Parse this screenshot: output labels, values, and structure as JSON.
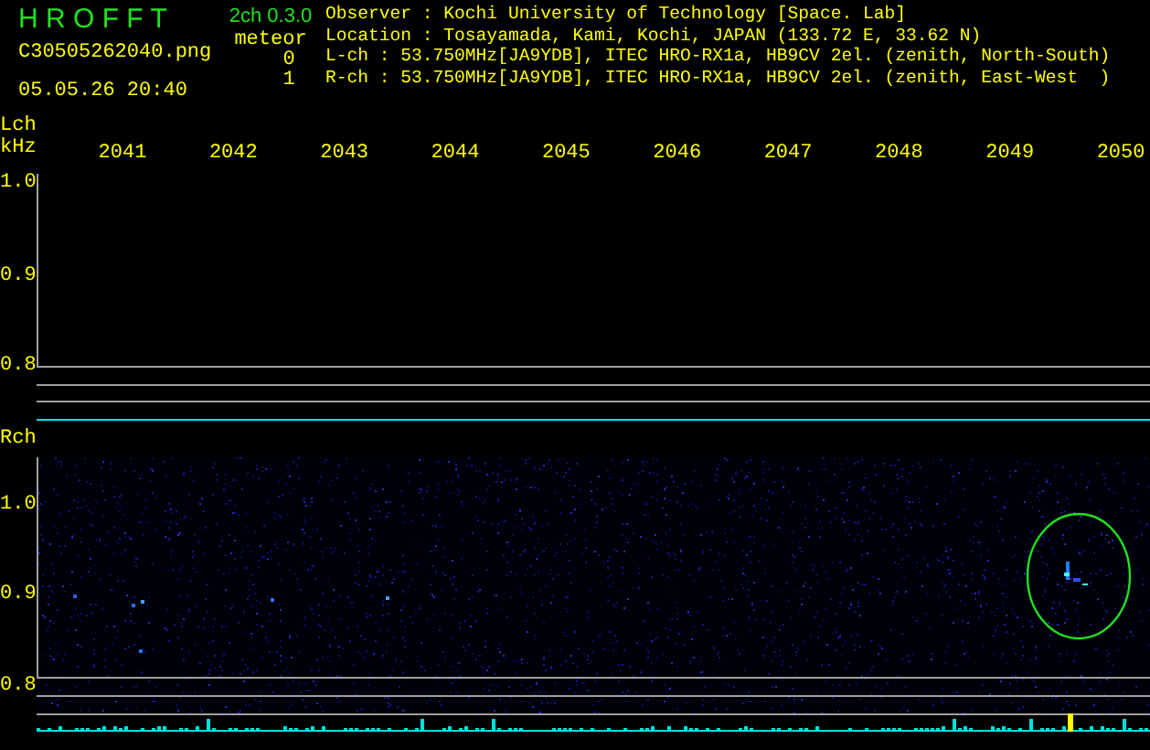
{
  "header": {
    "title": "H R O F F T",
    "version": "2ch 0.3.0",
    "filename": "C30505262040.png",
    "timestamp": "05.05.26 20:40"
  },
  "meteor": {
    "label": "meteor",
    "counts": [
      "0",
      "1"
    ]
  },
  "info": [
    "Observer : Kochi University of Technology [Space. Lab]",
    "Location : Tosayamada, Kami, Kochi, JAPAN (133.72 E, 33.62 N)",
    "L-ch : 53.750MHz[JA9YDB], ITEC HRO-RX1a, HB9CV 2el. (zenith, North-South)",
    "R-ch : 53.750MHz[JA9YDB], ITEC HRO-RX1a, HB9CV 2el. (zenith, East-West  )"
  ],
  "time_axis": {
    "ticks": [
      "2041",
      "2042",
      "2043",
      "2044",
      "2045",
      "2046",
      "2047",
      "2048",
      "2049",
      "2050"
    ]
  },
  "channels": [
    {
      "label": "Lch",
      "unit": "kHz",
      "y_ticks": [
        "1.0",
        "0.9",
        "0.8"
      ],
      "signal": false,
      "detection": false
    },
    {
      "label": "Rch",
      "y_ticks": [
        "1.0",
        "0.9",
        "0.8"
      ],
      "signal": true,
      "detection": true
    }
  ]
}
